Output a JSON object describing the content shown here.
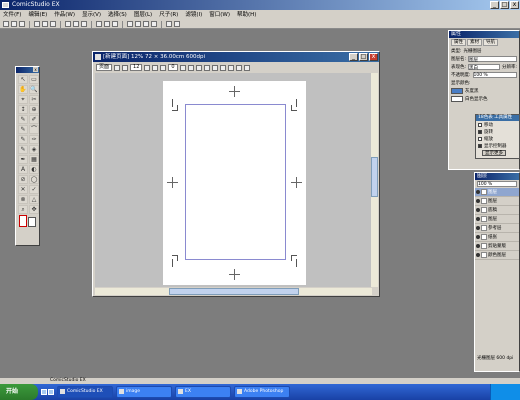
{
  "app": {
    "title": "ComicStudio EX",
    "window_buttons": [
      "_",
      "□",
      "x"
    ]
  },
  "menu": [
    {
      "label": "文件(F)"
    },
    {
      "label": "编辑(E)"
    },
    {
      "label": "作品(W)"
    },
    {
      "label": "显示(V)"
    },
    {
      "label": "选择(S)"
    },
    {
      "label": "图层(L)"
    },
    {
      "label": "尺子(R)"
    },
    {
      "label": "滤镜(I)"
    },
    {
      "label": "窗口(W)"
    },
    {
      "label": "帮助(H)"
    }
  ],
  "tool_palette": {
    "close": "x",
    "tools": [
      "↖",
      "▭",
      "✋",
      "🔍",
      "⌖",
      "✂",
      "↕",
      "⊕",
      "✎",
      "✐",
      "✎",
      "⌒",
      "✎",
      "✑",
      "✎",
      "◈",
      "✒",
      "▦",
      "A",
      "◐",
      "⊘",
      "◯",
      "✕",
      "✓",
      "⊗",
      "△",
      "⌕",
      "✥"
    ]
  },
  "document": {
    "title": "[新建页面] 12% 72 × 36.00cm 600dpi",
    "toolbar": {
      "mode_label": "页面",
      "zoom": "12",
      "angle": "0"
    },
    "window_buttons": [
      "_",
      "□",
      "x"
    ]
  },
  "properties_panel": {
    "title": "属性",
    "tabs": [
      {
        "label": "属性"
      },
      {
        "label": "素材"
      },
      {
        "label": "导航"
      }
    ],
    "rows": [
      {
        "label": "类型:",
        "value": "光栅图层"
      },
      {
        "label": "图层名:",
        "value": "图层"
      },
      {
        "label": "表现色:",
        "value": "黑白",
        "extra": "分辨率:"
      },
      {
        "label": "不透明度:",
        "value": "100 %"
      },
      {
        "label": "显示颜色:",
        "value": "灰度黑",
        "extra": "白色显示色"
      }
    ]
  },
  "sub_dialog": {
    "title": "18色表  工具属性",
    "options": [
      {
        "label": "移动",
        "checked": false
      },
      {
        "label": "旋转",
        "checked": true
      },
      {
        "label": "缩放",
        "checked": false
      },
      {
        "label": "显示控制器",
        "checked": true
      }
    ],
    "button_label": "显示更多"
  },
  "layer_panel": {
    "title": "图层",
    "opacity": "100 %",
    "layers": [
      {
        "name": "图层",
        "selected": true
      },
      {
        "name": "图层",
        "selected": false
      },
      {
        "name": "底稿",
        "selected": false
      },
      {
        "name": "图层",
        "selected": false
      },
      {
        "name": "参考层",
        "selected": false
      },
      {
        "name": "纸张",
        "selected": false
      },
      {
        "name": "剪贴蒙版",
        "selected": false
      },
      {
        "name": "颜色图层",
        "selected": false
      }
    ],
    "footer": "光栅图层  600 dpi"
  },
  "status_bar": {
    "text": "ComicStudio EX"
  },
  "taskbar": {
    "start_label": "开始",
    "buttons": [
      {
        "label": "ComicStudio EX",
        "active": true
      },
      {
        "label": "image",
        "active": false
      },
      {
        "label": "EX",
        "active": false
      },
      {
        "label": "Adobe Photoshop",
        "active": false
      }
    ]
  }
}
